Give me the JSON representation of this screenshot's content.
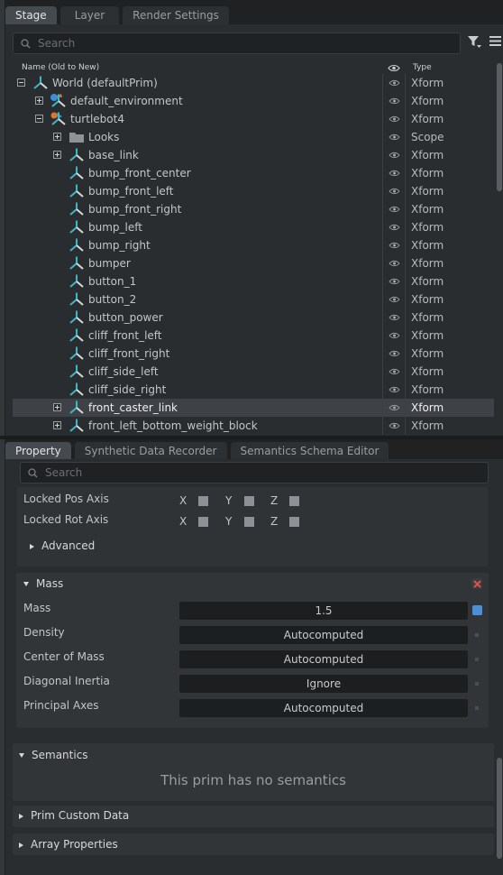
{
  "stage_panel": {
    "tabs": [
      "Stage",
      "Layer",
      "Render Settings"
    ],
    "search_placeholder": "Search",
    "col_name": "Name (Old to New)",
    "col_type": "Type",
    "rows": [
      {
        "label": "World (defaultPrim)",
        "type": "Xform",
        "expander": "minus",
        "icon": "xform-icon",
        "depth": 0
      },
      {
        "label": "default_environment",
        "type": "Xform",
        "expander": "plus",
        "icon": "environment-xform-icon",
        "depth": 1
      },
      {
        "label": "turtlebot4",
        "type": "Xform",
        "expander": "minus",
        "icon": "robot-xform-icon",
        "depth": 1
      },
      {
        "label": "Looks",
        "type": "Scope",
        "expander": "plus",
        "icon": "folder-icon",
        "depth": 2
      },
      {
        "label": "base_link",
        "type": "Xform",
        "expander": "plus",
        "icon": "xform-icon",
        "depth": 2
      },
      {
        "label": "bump_front_center",
        "type": "Xform",
        "icon": "xform-icon",
        "depth": 2
      },
      {
        "label": "bump_front_left",
        "type": "Xform",
        "icon": "xform-icon",
        "depth": 2
      },
      {
        "label": "bump_front_right",
        "type": "Xform",
        "icon": "xform-icon",
        "depth": 2
      },
      {
        "label": "bump_left",
        "type": "Xform",
        "icon": "xform-icon",
        "depth": 2
      },
      {
        "label": "bump_right",
        "type": "Xform",
        "icon": "xform-icon",
        "depth": 2
      },
      {
        "label": "bumper",
        "type": "Xform",
        "icon": "xform-icon",
        "depth": 2
      },
      {
        "label": "button_1",
        "type": "Xform",
        "icon": "xform-icon",
        "depth": 2
      },
      {
        "label": "button_2",
        "type": "Xform",
        "icon": "xform-icon",
        "depth": 2
      },
      {
        "label": "button_power",
        "type": "Xform",
        "icon": "xform-icon",
        "depth": 2
      },
      {
        "label": "cliff_front_left",
        "type": "Xform",
        "icon": "xform-icon",
        "depth": 2
      },
      {
        "label": "cliff_front_right",
        "type": "Xform",
        "icon": "xform-icon",
        "depth": 2
      },
      {
        "label": "cliff_side_left",
        "type": "Xform",
        "icon": "xform-icon",
        "depth": 2
      },
      {
        "label": "cliff_side_right",
        "type": "Xform",
        "icon": "xform-icon",
        "depth": 2
      },
      {
        "label": "front_caster_link",
        "type": "Xform",
        "expander": "plus",
        "icon": "xform-icon",
        "depth": 2,
        "selected": true
      },
      {
        "label": "front_left_bottom_weight_block",
        "type": "Xform",
        "expander": "plus",
        "icon": "xform-icon",
        "depth": 2
      }
    ]
  },
  "property_panel": {
    "tabs": [
      "Property",
      "Synthetic Data Recorder",
      "Semantics Schema Editor"
    ],
    "search_placeholder": "Search",
    "locked_pos_label": "Locked Pos Axis",
    "locked_rot_label": "Locked Rot Axis",
    "axes": [
      "X",
      "Y",
      "Z"
    ],
    "advanced_label": "Advanced",
    "mass_section": {
      "title": "Mass",
      "rows": [
        {
          "label": "Mass",
          "value": "1.5"
        },
        {
          "label": "Density",
          "value": "Autocomputed"
        },
        {
          "label": "Center of Mass",
          "value": "Autocomputed"
        },
        {
          "label": "Diagonal Inertia",
          "value": "Ignore"
        },
        {
          "label": "Principal Axes",
          "value": "Autocomputed"
        }
      ]
    },
    "semantics_title": "Semantics",
    "semantics_message": "This prim has no semantics",
    "prim_custom_data_label": "Prim Custom Data",
    "array_properties_label": "Array Properties"
  },
  "colors": {
    "accent_blue": "#4a90d9",
    "close_red": "#d9534f",
    "selected_row": "#3e4246"
  }
}
